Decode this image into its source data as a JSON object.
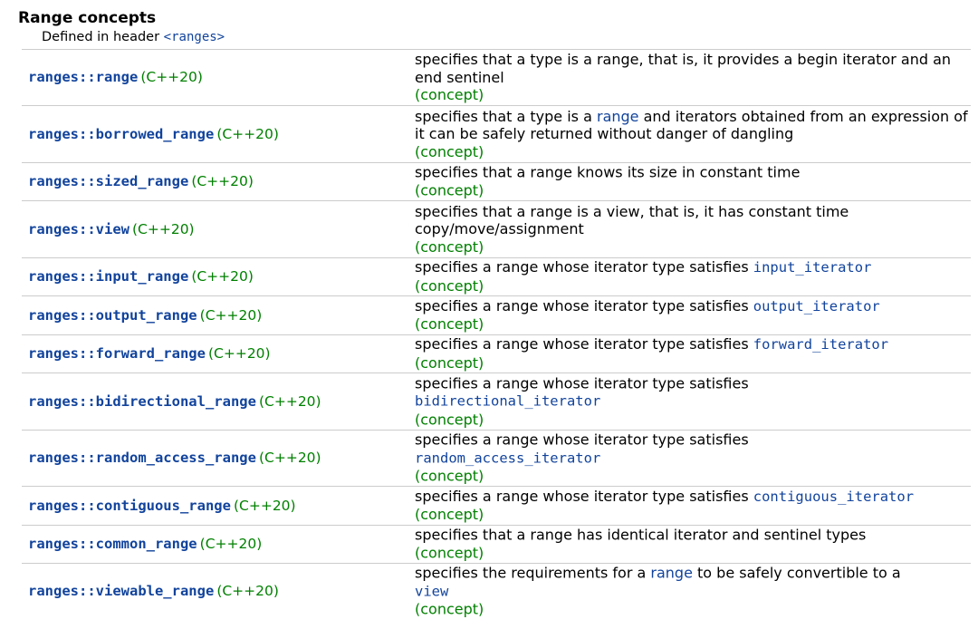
{
  "section_title": "Range concepts",
  "defined_in": {
    "prefix": "Defined in header ",
    "header": "<ranges>"
  },
  "rows": [
    {
      "name": "ranges::range",
      "std": "(C++20)",
      "desc": [
        {
          "t": "specifies that a type is a range, that is, it provides a begin iterator and an end sentinel"
        }
      ],
      "kind": "(concept)"
    },
    {
      "name": "ranges::borrowed_range",
      "std": "(C++20)",
      "desc": [
        {
          "t": "specifies that a type is a "
        },
        {
          "t": "range",
          "c": "link"
        },
        {
          "t": " and iterators obtained from an expression of it can be safely returned without danger of dangling"
        }
      ],
      "kind": "(concept)"
    },
    {
      "name": "ranges::sized_range",
      "std": "(C++20)",
      "desc": [
        {
          "t": "specifies that a range knows its size in constant time"
        }
      ],
      "kind": "(concept)"
    },
    {
      "name": "ranges::view",
      "std": "(C++20)",
      "desc": [
        {
          "t": "specifies that a range is a view, that is, it has constant time copy/move/assignment"
        }
      ],
      "kind": "(concept)"
    },
    {
      "name": "ranges::input_range",
      "std": "(C++20)",
      "desc": [
        {
          "t": "specifies a range whose iterator type satisfies "
        },
        {
          "t": "input_iterator",
          "c": "code"
        }
      ],
      "kind": "(concept)"
    },
    {
      "name": "ranges::output_range",
      "std": "(C++20)",
      "desc": [
        {
          "t": "specifies a range whose iterator type satisfies "
        },
        {
          "t": "output_iterator",
          "c": "code"
        }
      ],
      "kind": "(concept)"
    },
    {
      "name": "ranges::forward_range",
      "std": "(C++20)",
      "desc": [
        {
          "t": "specifies a range whose iterator type satisfies "
        },
        {
          "t": "forward_iterator",
          "c": "code"
        }
      ],
      "kind": "(concept)"
    },
    {
      "name": "ranges::bidirectional_range",
      "std": "(C++20)",
      "desc": [
        {
          "t": "specifies a range whose iterator type satisfies "
        },
        {
          "br": true
        },
        {
          "t": "bidirectional_iterator",
          "c": "code"
        }
      ],
      "kind": "(concept)"
    },
    {
      "name": "ranges::random_access_range",
      "std": "(C++20)",
      "desc": [
        {
          "t": "specifies a range whose iterator type satisfies "
        },
        {
          "br": true
        },
        {
          "t": "random_access_iterator",
          "c": "code"
        }
      ],
      "kind": "(concept)"
    },
    {
      "name": "ranges::contiguous_range",
      "std": "(C++20)",
      "desc": [
        {
          "t": "specifies a range whose iterator type satisfies "
        },
        {
          "t": "contiguous_iterator",
          "c": "code"
        }
      ],
      "kind": "(concept)"
    },
    {
      "name": "ranges::common_range",
      "std": "(C++20)",
      "desc": [
        {
          "t": "specifies that a range has identical iterator and sentinel types"
        }
      ],
      "kind": "(concept)"
    },
    {
      "name": "ranges::viewable_range",
      "std": "(C++20)",
      "desc": [
        {
          "t": "specifies the requirements for a "
        },
        {
          "t": "range",
          "c": "link"
        },
        {
          "t": " to be safely convertible to a "
        },
        {
          "br": true
        },
        {
          "t": "view",
          "c": "code"
        }
      ],
      "kind": "(concept)"
    }
  ]
}
